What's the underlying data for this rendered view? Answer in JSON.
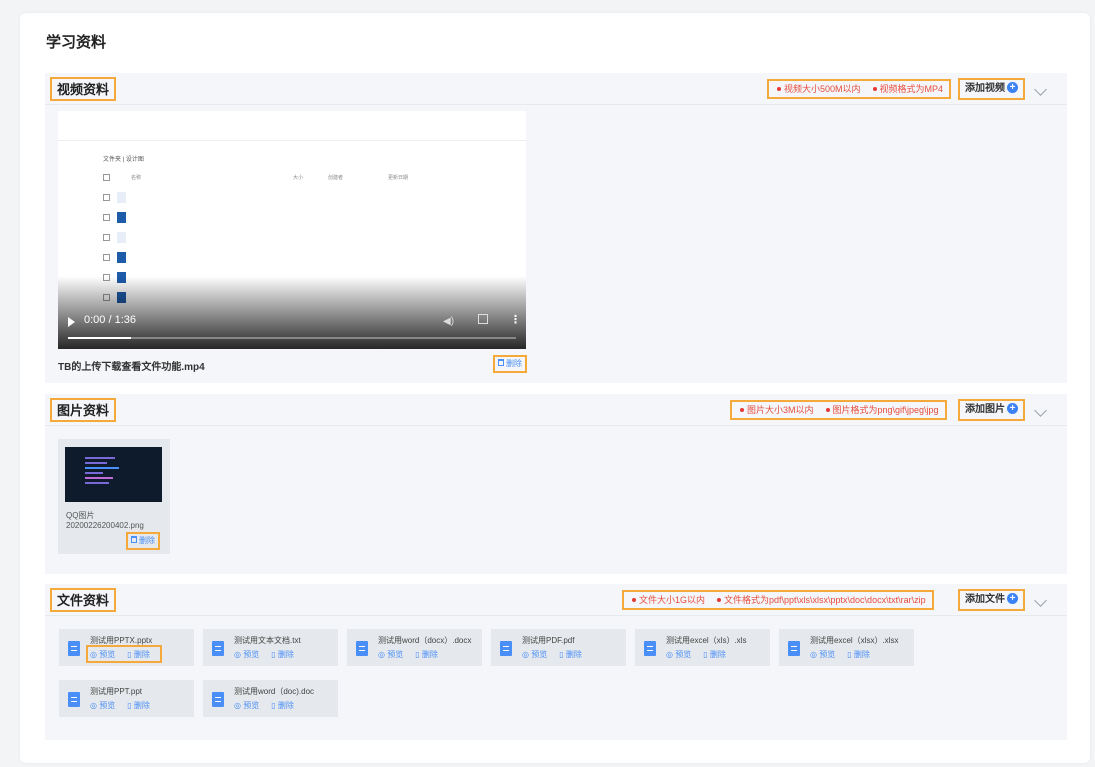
{
  "page": {
    "title": "学习资料"
  },
  "video_section": {
    "title": "视频资料",
    "hints": [
      "视频大小500M以内",
      "视频格式为MP4"
    ],
    "add_label": "添加视频",
    "player": {
      "time": "0:00 / 1:36",
      "progress": 0.14
    },
    "video_name": "TB的上传下载查看文件功能.mp4",
    "delete_label": "删除"
  },
  "image_section": {
    "title": "图片资料",
    "hints": [
      "图片大小3M以内",
      "图片格式为png\\gif\\jpeg\\jpg"
    ],
    "add_label": "添加图片",
    "image": {
      "name_line1": "QQ图片",
      "name_line2": "20200226200402.png",
      "delete_label": "删除"
    }
  },
  "file_section": {
    "title": "文件资料",
    "hints": [
      "文件大小1G以内",
      "文件格式为pdf\\ppt\\xls\\xlsx\\pptx\\doc\\docx\\txt\\rar\\zip"
    ],
    "add_label": "添加文件",
    "preview_label": "预览",
    "delete_label": "删除",
    "files": [
      {
        "name": "测试用PPTX.pptx"
      },
      {
        "name": "测试用文本文档.txt"
      },
      {
        "name": "测试用word（docx）.docx"
      },
      {
        "name": "测试用PDF.pdf"
      },
      {
        "name": "测试用excel（xls）.xls"
      },
      {
        "name": "测试用excel（xlsx）.xlsx"
      },
      {
        "name": "测试用PPT.ppt"
      },
      {
        "name": "测试用word（doc).doc"
      }
    ]
  },
  "colors": {
    "accent": "#4a8ff7",
    "highlight": "#f5a93a",
    "hint_red": "#e53935"
  }
}
